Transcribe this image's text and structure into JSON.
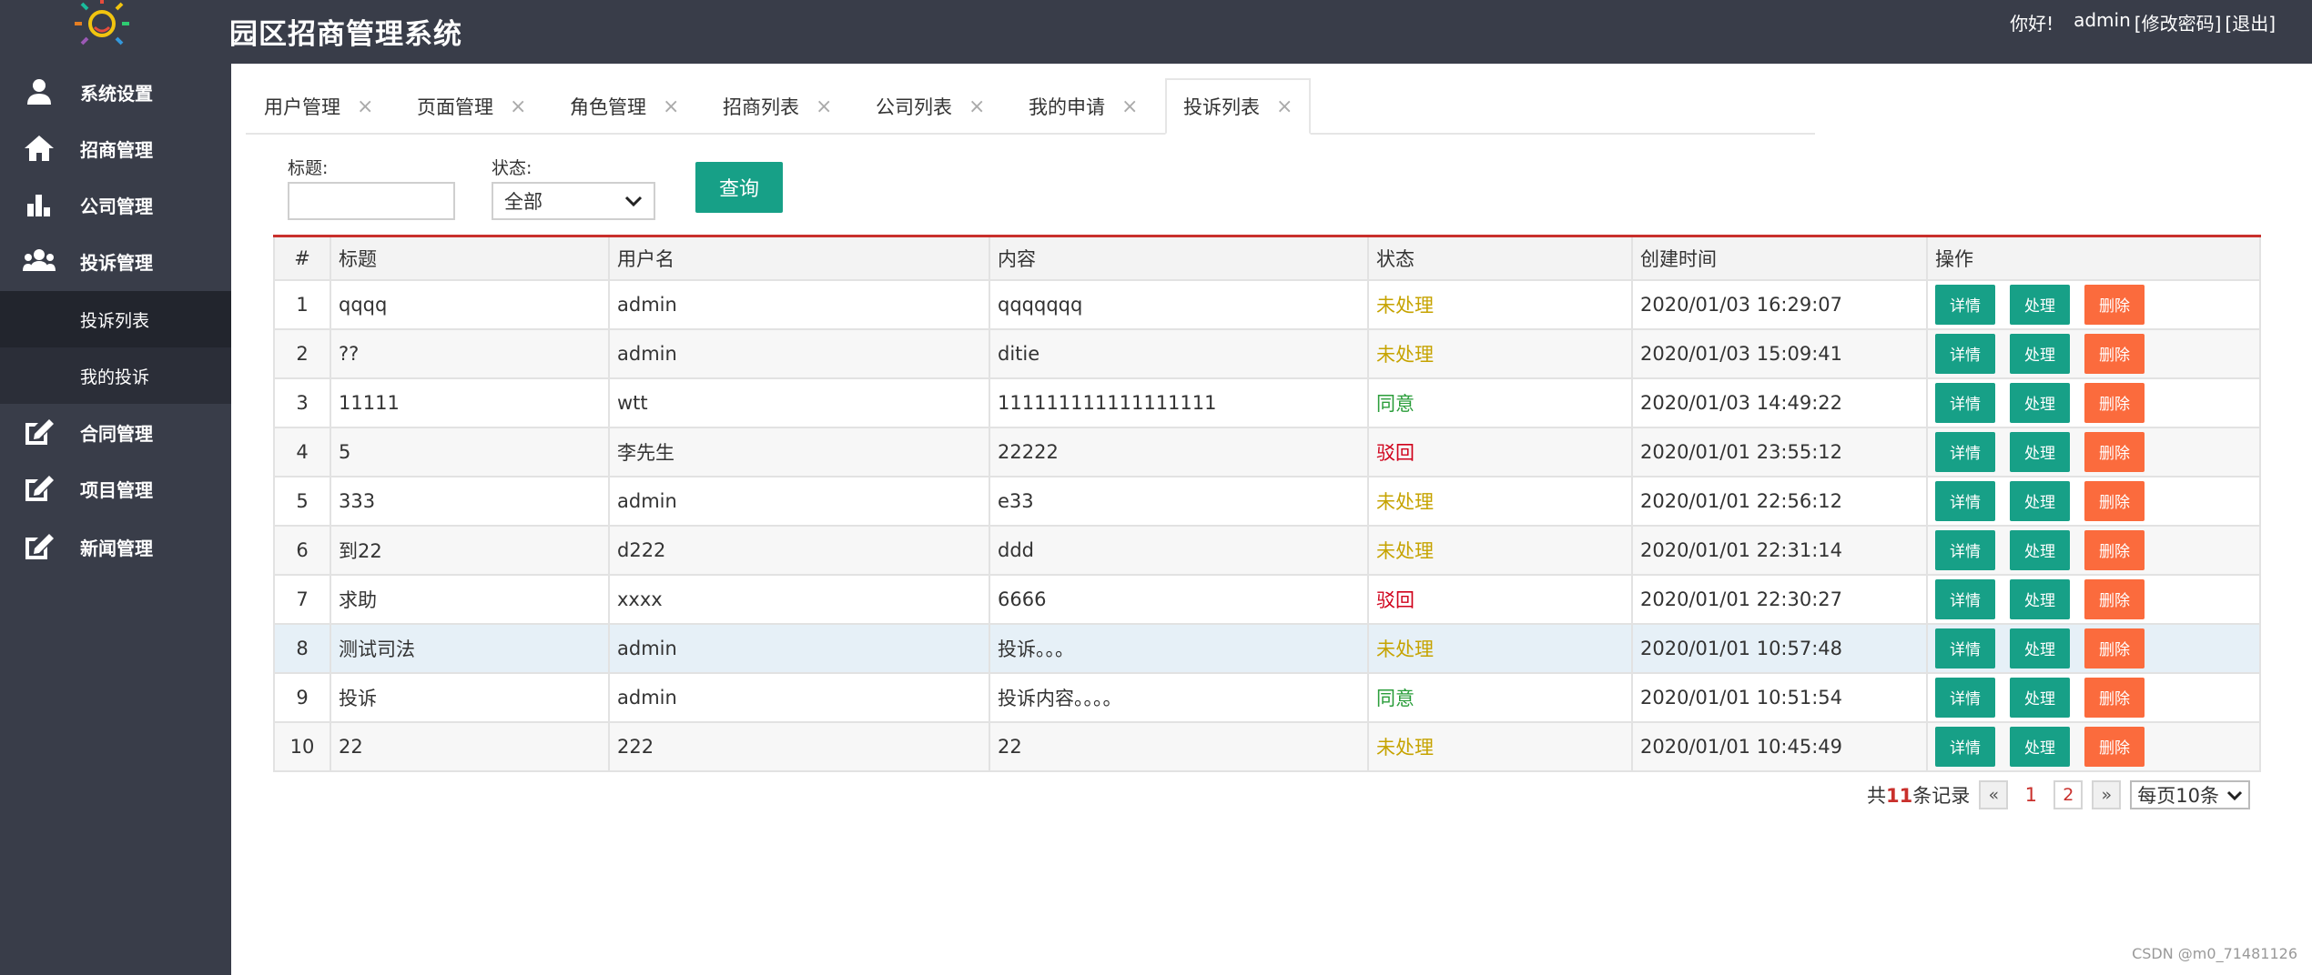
{
  "header": {
    "title": "园区招商管理系统",
    "greeting": "你好!",
    "username": "admin",
    "change_password": "[修改密码]",
    "logout": "[退出]"
  },
  "sidebar": {
    "items": [
      {
        "label": "系统设置",
        "icon": "user-icon"
      },
      {
        "label": "招商管理",
        "icon": "home-icon"
      },
      {
        "label": "公司管理",
        "icon": "bar-chart-icon"
      },
      {
        "label": "投诉管理",
        "icon": "group-icon"
      },
      {
        "label": "合同管理",
        "icon": "edit-icon"
      },
      {
        "label": "项目管理",
        "icon": "edit-icon"
      },
      {
        "label": "新闻管理",
        "icon": "edit-icon"
      }
    ],
    "sub_items": [
      {
        "label": "投诉列表"
      },
      {
        "label": "我的投诉"
      }
    ]
  },
  "tabs": [
    {
      "label": "用户管理",
      "close": "×"
    },
    {
      "label": "页面管理",
      "close": "×"
    },
    {
      "label": "角色管理",
      "close": "×"
    },
    {
      "label": "招商列表",
      "close": "×"
    },
    {
      "label": "公司列表",
      "close": "×"
    },
    {
      "label": "我的申请",
      "close": "×"
    },
    {
      "label": "投诉列表",
      "close": "×"
    }
  ],
  "search": {
    "title_label": "标题:",
    "title_value": "",
    "status_label": "状态:",
    "status_value": "全部",
    "query_button": "查询"
  },
  "table": {
    "headers": [
      "#",
      "标题",
      "用户名",
      "内容",
      "状态",
      "创建时间",
      "操作"
    ],
    "rows": [
      {
        "no": "1",
        "title": "qqqq",
        "user": "admin",
        "content": "qqqqqqq",
        "status": "未处理",
        "time": "2020/01/03 16:29:07"
      },
      {
        "no": "2",
        "title": "??",
        "user": "admin",
        "content": "ditie",
        "status": "未处理",
        "time": "2020/01/03 15:09:41"
      },
      {
        "no": "3",
        "title": "11111",
        "user": "wtt",
        "content": "111111111111111111",
        "status": "同意",
        "time": "2020/01/03 14:49:22"
      },
      {
        "no": "4",
        "title": "5",
        "user": "李先生",
        "content": "22222",
        "status": "驳回",
        "time": "2020/01/01 23:55:12"
      },
      {
        "no": "5",
        "title": "333",
        "user": "admin",
        "content": "e33",
        "status": "未处理",
        "time": "2020/01/01 22:56:12"
      },
      {
        "no": "6",
        "title": "到22",
        "user": "d222",
        "content": "ddd",
        "status": "未处理",
        "time": "2020/01/01 22:31:14"
      },
      {
        "no": "7",
        "title": "求助",
        "user": "xxxx",
        "content": "6666",
        "status": "驳回",
        "time": "2020/01/01 22:30:27"
      },
      {
        "no": "8",
        "title": "测试司法",
        "user": "admin",
        "content": "投诉。。。",
        "status": "未处理",
        "time": "2020/01/01 10:57:48"
      },
      {
        "no": "9",
        "title": "投诉",
        "user": "admin",
        "content": "投诉内容。。。。",
        "status": "同意",
        "time": "2020/01/01 10:51:54"
      },
      {
        "no": "10",
        "title": "22",
        "user": "222",
        "content": "22",
        "status": "未处理",
        "time": "2020/01/01 10:45:49"
      }
    ],
    "actions": {
      "detail": "详情",
      "handle": "处理",
      "delete": "删除"
    }
  },
  "pagination": {
    "total_prefix": "共",
    "total_count": "11",
    "total_suffix": "条记录",
    "prev": "«",
    "page1": "1",
    "page2": "2",
    "next": "»",
    "per_page": "每页10条"
  },
  "footer": {
    "watermark": "CSDN @m0_71481126"
  },
  "colors": {
    "header_bg": "#393d49",
    "primary_btn": "#17a087",
    "delete_btn": "#fb6b3d",
    "pending": "#c6a300",
    "agree": "#2a9d3a",
    "reject": "#d0021b"
  }
}
